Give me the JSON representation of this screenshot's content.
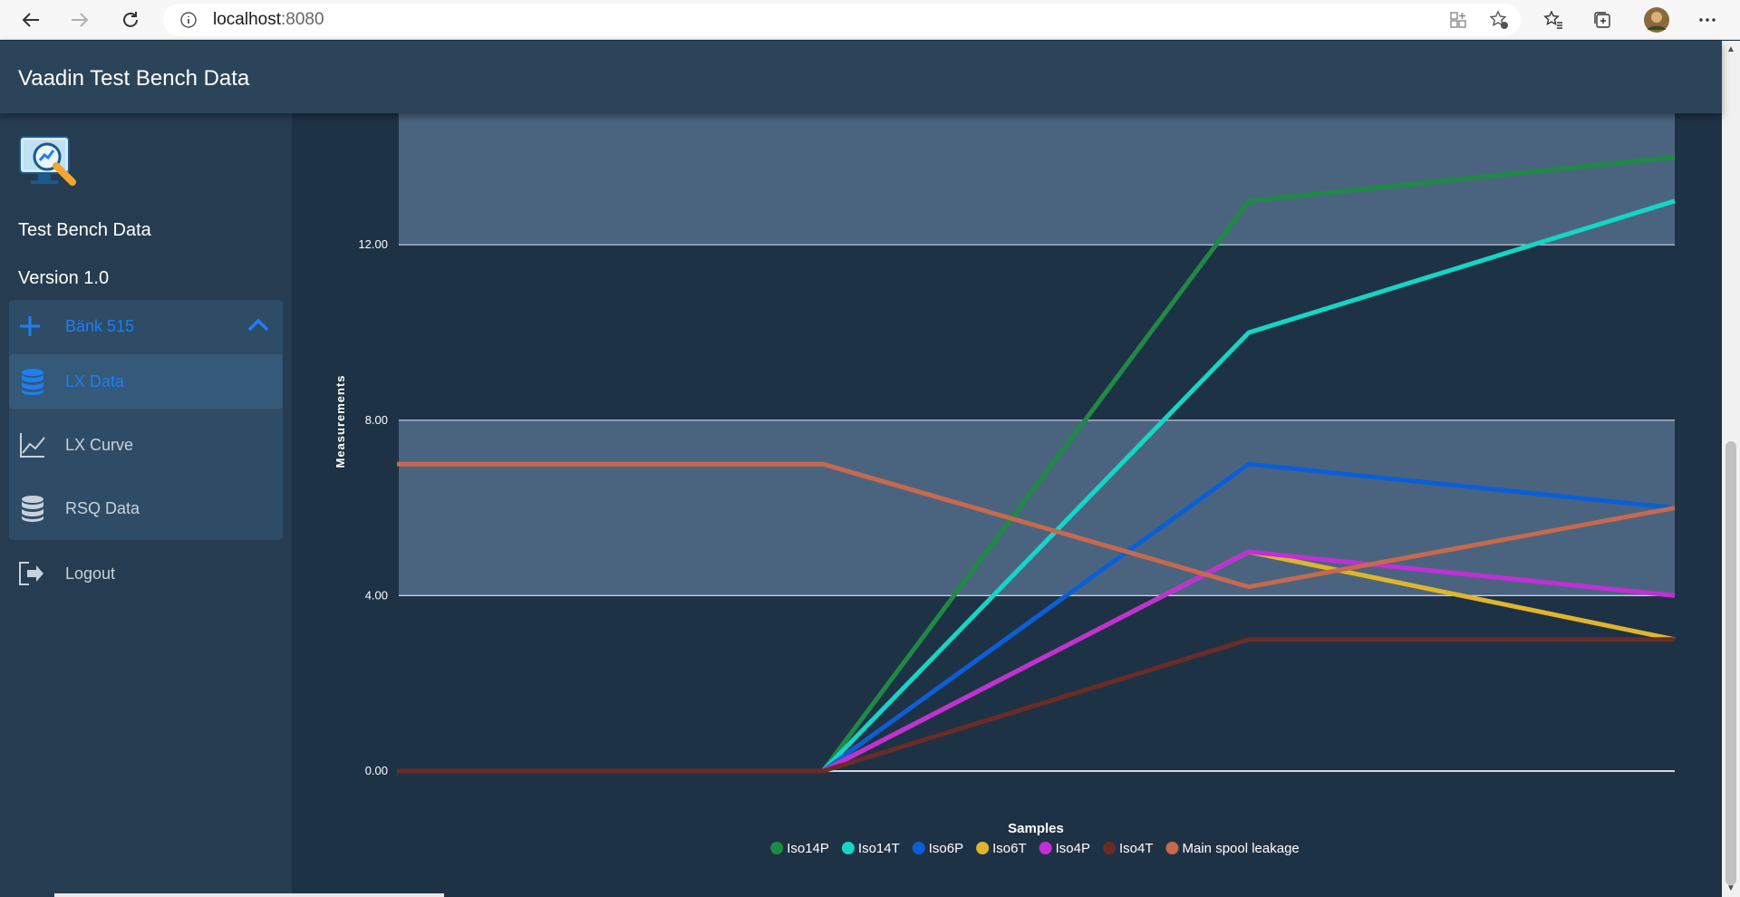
{
  "browser": {
    "url_host": "localhost",
    "url_port": ":8080"
  },
  "app": {
    "title": "Vaadin Test Bench Data"
  },
  "sidebar": {
    "app_name": "Test Bench Data",
    "version": "Version 1.0",
    "group_label": "Bänk 515",
    "items": [
      {
        "label": "LX Data",
        "active": true
      },
      {
        "label": "LX Curve",
        "active": false
      },
      {
        "label": "RSQ Data",
        "active": false
      }
    ],
    "logout_label": "Logout"
  },
  "colors": {
    "accent": "#1f7ef2",
    "band": "#4a6480",
    "background": "#1e3246"
  },
  "chart_data": {
    "type": "line",
    "xlabel": "Samples",
    "ylabel": "Measurements",
    "x": [
      1,
      2,
      3,
      4
    ],
    "ylim": [
      0,
      15
    ],
    "yticks": [
      "0.00",
      "4.00",
      "8.00",
      "12.00"
    ],
    "ytick_values": [
      0,
      4,
      8,
      12
    ],
    "bands": [
      [
        4,
        8
      ],
      [
        12,
        15
      ]
    ],
    "grid": true,
    "legend_position": "bottom",
    "series": [
      {
        "name": "Iso14P",
        "color": "#1f8a45",
        "values": [
          0,
          0,
          13,
          14
        ]
      },
      {
        "name": "Iso14T",
        "color": "#15d6c4",
        "values": [
          0,
          0,
          10,
          13
        ]
      },
      {
        "name": "Iso6P",
        "color": "#0a5fd6",
        "values": [
          0,
          0,
          7,
          6
        ]
      },
      {
        "name": "Iso6T",
        "color": "#e0b52c",
        "values": [
          0,
          0,
          5,
          3
        ]
      },
      {
        "name": "Iso4P",
        "color": "#c22fd6",
        "values": [
          0,
          0,
          5,
          4
        ]
      },
      {
        "name": "Iso4T",
        "color": "#6b2b26",
        "values": [
          0,
          0,
          3,
          3
        ]
      },
      {
        "name": "Main spool leakage",
        "color": "#c6694d",
        "values": [
          7,
          7,
          4.2,
          6
        ]
      }
    ]
  }
}
